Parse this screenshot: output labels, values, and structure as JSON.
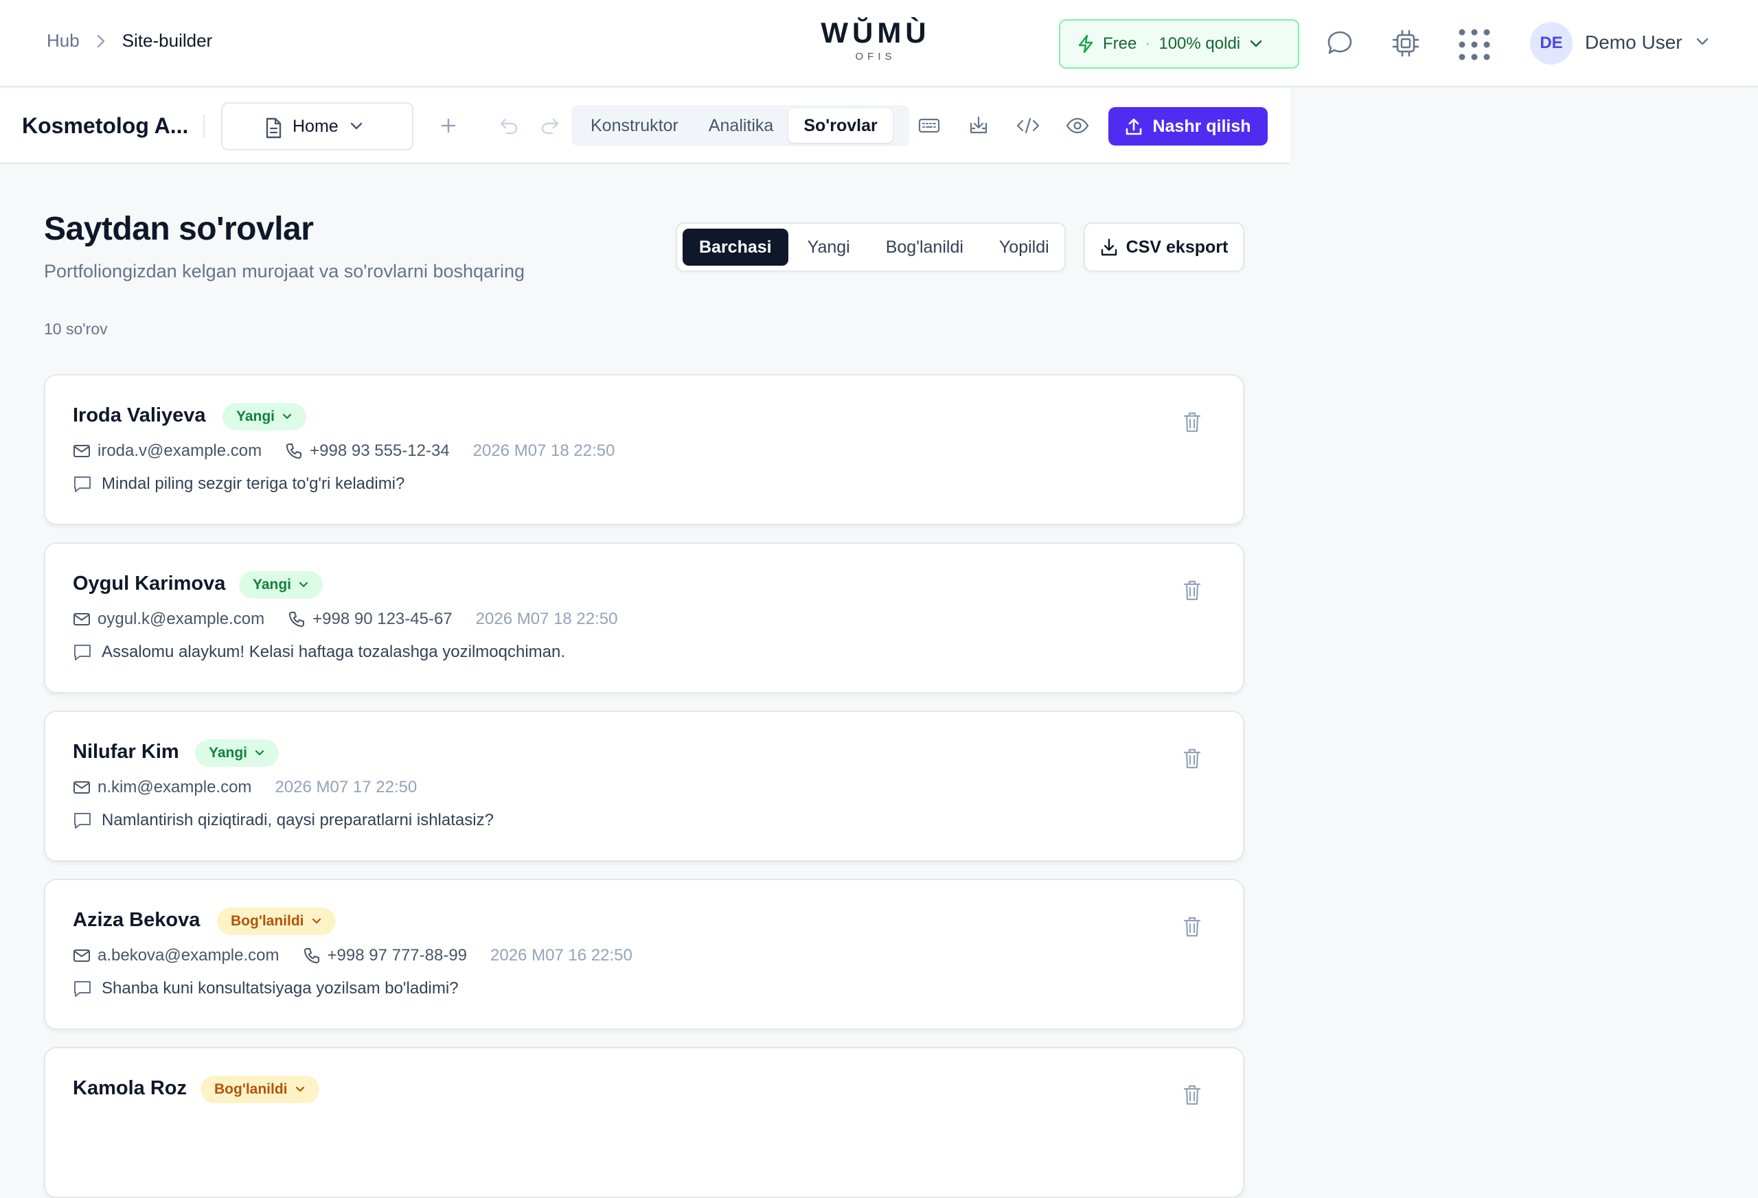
{
  "breadcrumb": {
    "root": "Hub",
    "current": "Site-builder"
  },
  "logo": {
    "mark": "WŬMÙ",
    "sub": "OFIS"
  },
  "plan": {
    "tier": "Free",
    "sep": "·",
    "remaining": "100% qoldi"
  },
  "user": {
    "initials": "DE",
    "name": "Demo User"
  },
  "toolbar": {
    "site_name": "Kosmetolog A...",
    "page": "Home",
    "tabs": [
      {
        "label": "Konstruktor"
      },
      {
        "label": "Analitika"
      },
      {
        "label": "So'rovlar"
      }
    ],
    "active_tab": "So'rovlar",
    "publish_label": "Nashr qilish"
  },
  "page": {
    "title": "Saytdan so'rovlar",
    "subtitle": "Portfoliongizdan kelgan murojaat va so'rovlarni boshqaring",
    "count": "10 so'rov",
    "filters": [
      {
        "label": "Barchasi"
      },
      {
        "label": "Yangi"
      },
      {
        "label": "Bog'lanildi"
      },
      {
        "label": "Yopildi"
      }
    ],
    "active_filter": "Barchasi",
    "export_label": "CSV eksport"
  },
  "requests": [
    {
      "name": "Iroda Valiyeva",
      "status": "Yangi",
      "email": "iroda.v@example.com",
      "phone": "+998 93 555-12-34",
      "date": "2026 M07 18 22:50",
      "message": "Mindal piling sezgir teriga to'g'ri keladimi?"
    },
    {
      "name": "Oygul Karimova",
      "status": "Yangi",
      "email": "oygul.k@example.com",
      "phone": "+998 90 123-45-67",
      "date": "2026 M07 18 22:50",
      "message": "Assalomu alaykum! Kelasi haftaga tozalashga yozilmoqchiman."
    },
    {
      "name": "Nilufar Kim",
      "status": "Yangi",
      "email": "n.kim@example.com",
      "phone": "",
      "date": "2026 M07 17 22:50",
      "message": "Namlantirish qiziqtiradi, qaysi preparatlarni ishlatasiz?"
    },
    {
      "name": "Aziza Bekova",
      "status": "Bog'lanildi",
      "email": "a.bekova@example.com",
      "phone": "+998 97 777-88-99",
      "date": "2026 M07 16 22:50",
      "message": "Shanba kuni konsultatsiyaga yozilsam bo'ladimi?"
    },
    {
      "name": "Kamola Roz",
      "status": "Bog'lanildi",
      "email": "",
      "phone": "",
      "date": "",
      "message": ""
    }
  ],
  "colors": {
    "accent": "#4f2cf0",
    "status_new_bg": "#dcfce7",
    "status_new_fg": "#15803d",
    "status_contacted_bg": "#fef3c7",
    "status_contacted_fg": "#b45309"
  },
  "icons": {
    "plan": "bolt-icon",
    "chat": "chat-bubble-icon",
    "chip": "cpu-chip-icon",
    "apps": "apps-grid-icon",
    "page": "document-icon",
    "add": "plus-icon",
    "undo": "undo-icon",
    "redo": "redo-icon",
    "keyboard": "keyboard-icon",
    "import": "download-tray-icon",
    "code": "code-icon",
    "preview": "eye-icon",
    "publish": "upload-icon",
    "export": "download-icon",
    "email": "mail-icon",
    "phone": "phone-icon",
    "message": "message-icon",
    "delete": "trash-icon"
  }
}
